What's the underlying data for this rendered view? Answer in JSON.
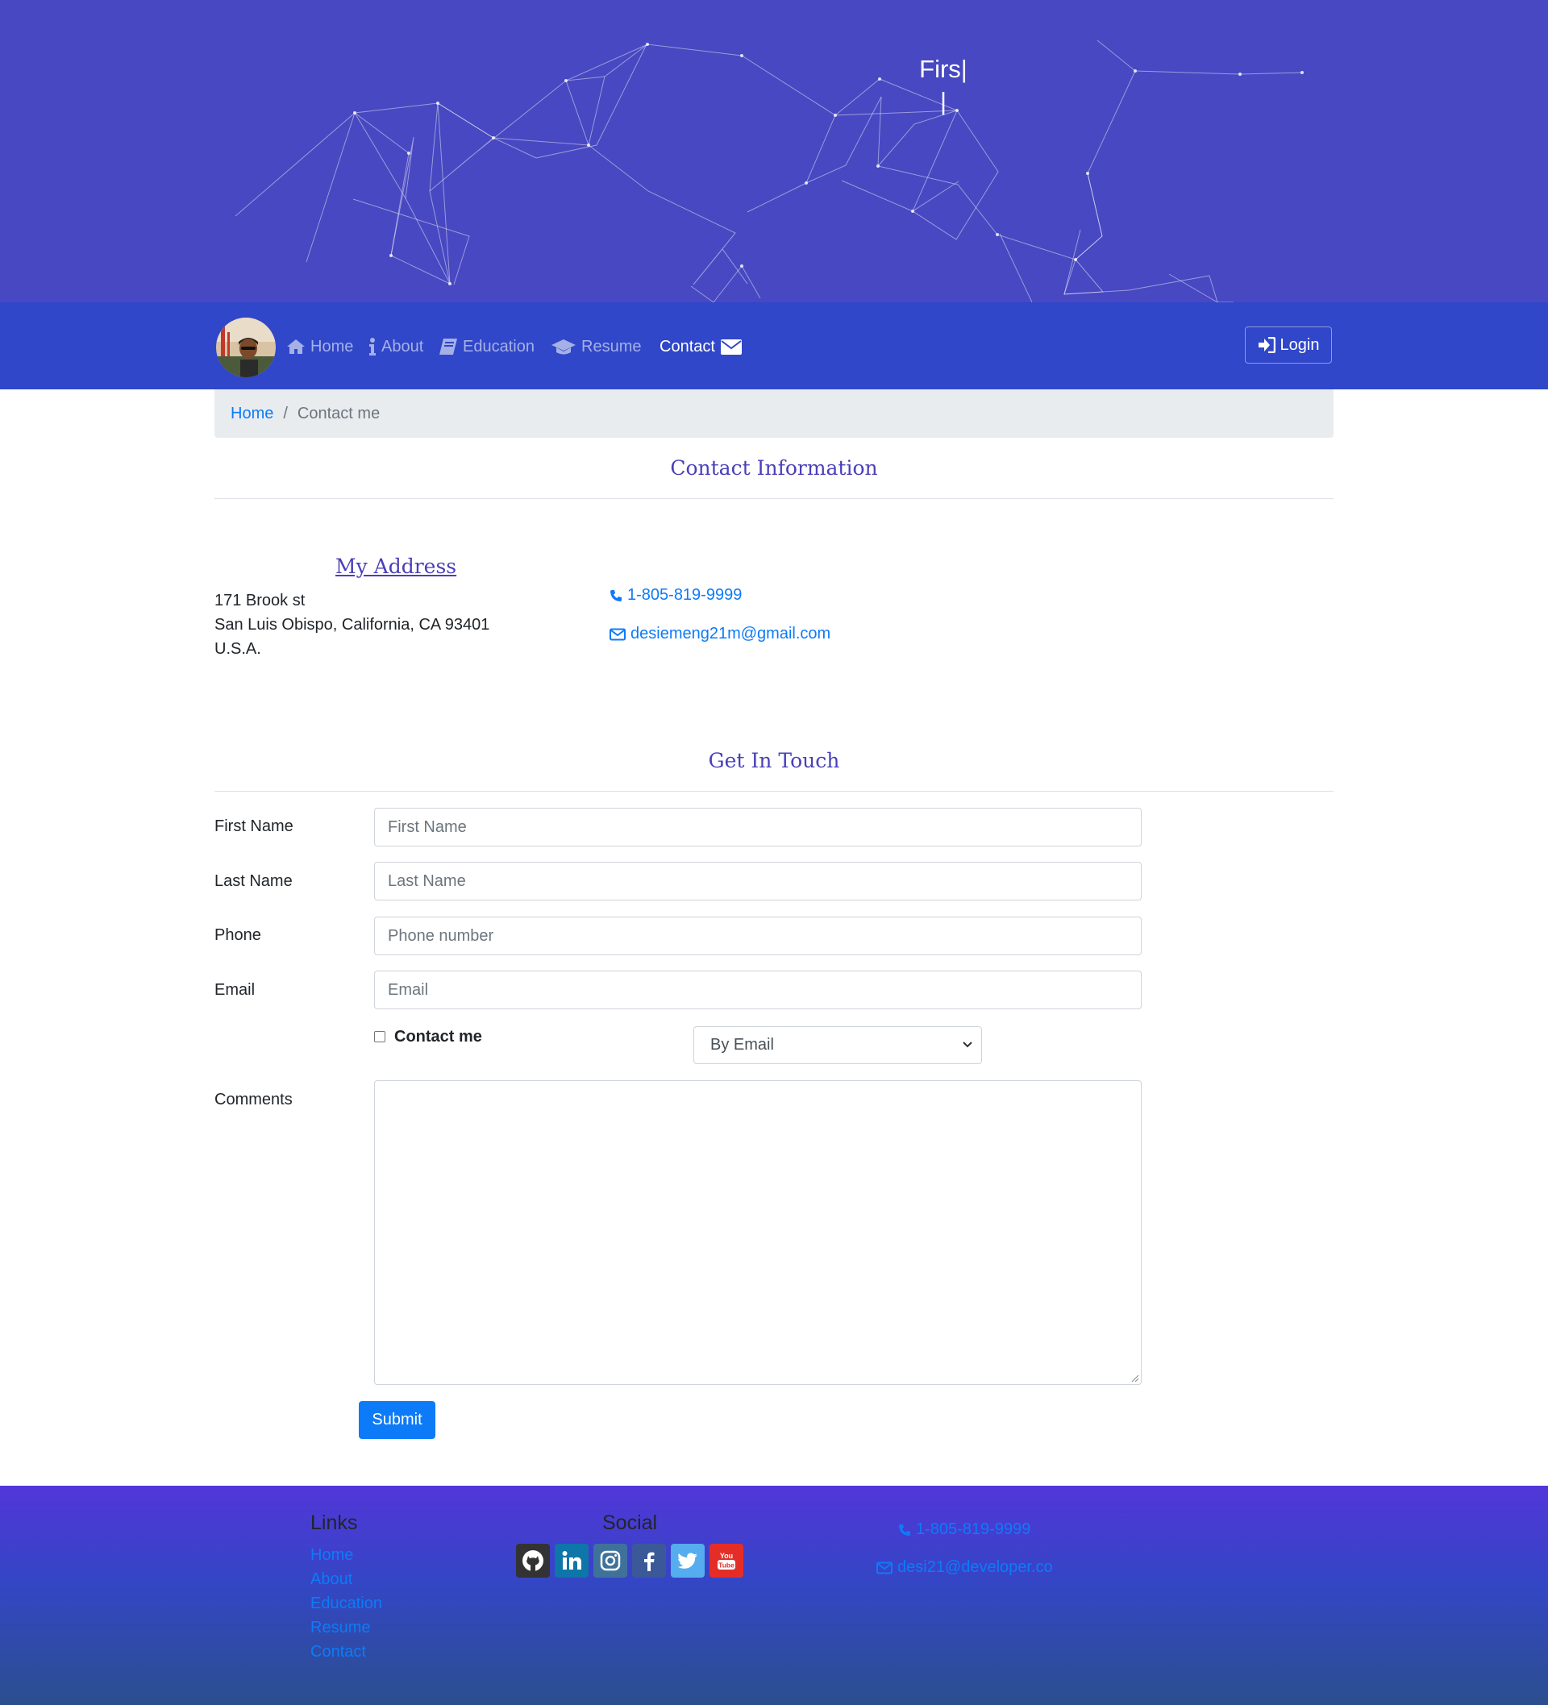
{
  "hero": {
    "typed_text": "Firs|",
    "cursor": "|"
  },
  "nav": {
    "avatar": "profile-photo",
    "items": [
      {
        "label": "Home",
        "icon": "home-icon"
      },
      {
        "label": "About",
        "icon": "info-icon"
      },
      {
        "label": "Education",
        "icon": "book-icon"
      },
      {
        "label": "Resume",
        "icon": "graduation-cap-icon"
      },
      {
        "label": "Contact",
        "icon": "envelope-icon",
        "active": true
      }
    ],
    "login_label": "Login"
  },
  "breadcrumb": {
    "home": "Home",
    "separator": "/",
    "current": "Contact me"
  },
  "contact_info": {
    "title": "Contact Information",
    "address_title": "My Address",
    "address_lines": [
      "171 Brook st",
      "San Luis Obispo, California, CA 93401",
      "U.S.A."
    ],
    "phone": "1-805-819-9999",
    "email": "desiemeng21m@gmail.com"
  },
  "form": {
    "title": "Get In Touch",
    "first_name_label": "First Name",
    "first_name_placeholder": "First Name",
    "last_name_label": "Last Name",
    "last_name_placeholder": "Last Name",
    "phone_label": "Phone",
    "phone_placeholder": "Phone number",
    "email_label": "Email",
    "email_placeholder": "Email",
    "contact_me_label": "Contact me",
    "contact_method": "By Email",
    "comments_label": "Comments",
    "submit_label": "Submit"
  },
  "footer": {
    "links_title": "Links",
    "links": [
      "Home",
      "About",
      "Education",
      "Resume",
      "Contact"
    ],
    "social_title": "Social",
    "social": [
      "github-icon",
      "linkedin-icon",
      "instagram-icon",
      "facebook-icon",
      "twitter-icon",
      "youtube-icon"
    ],
    "phone": "1-805-819-9999",
    "email": "desi21@developer.co"
  },
  "colors": {
    "hero_bg": "#4848c2",
    "navbar_bg": "#3047c9",
    "link": "#0d7bf8",
    "heading": "#4a3fb9",
    "button": "#0d7bf8"
  }
}
